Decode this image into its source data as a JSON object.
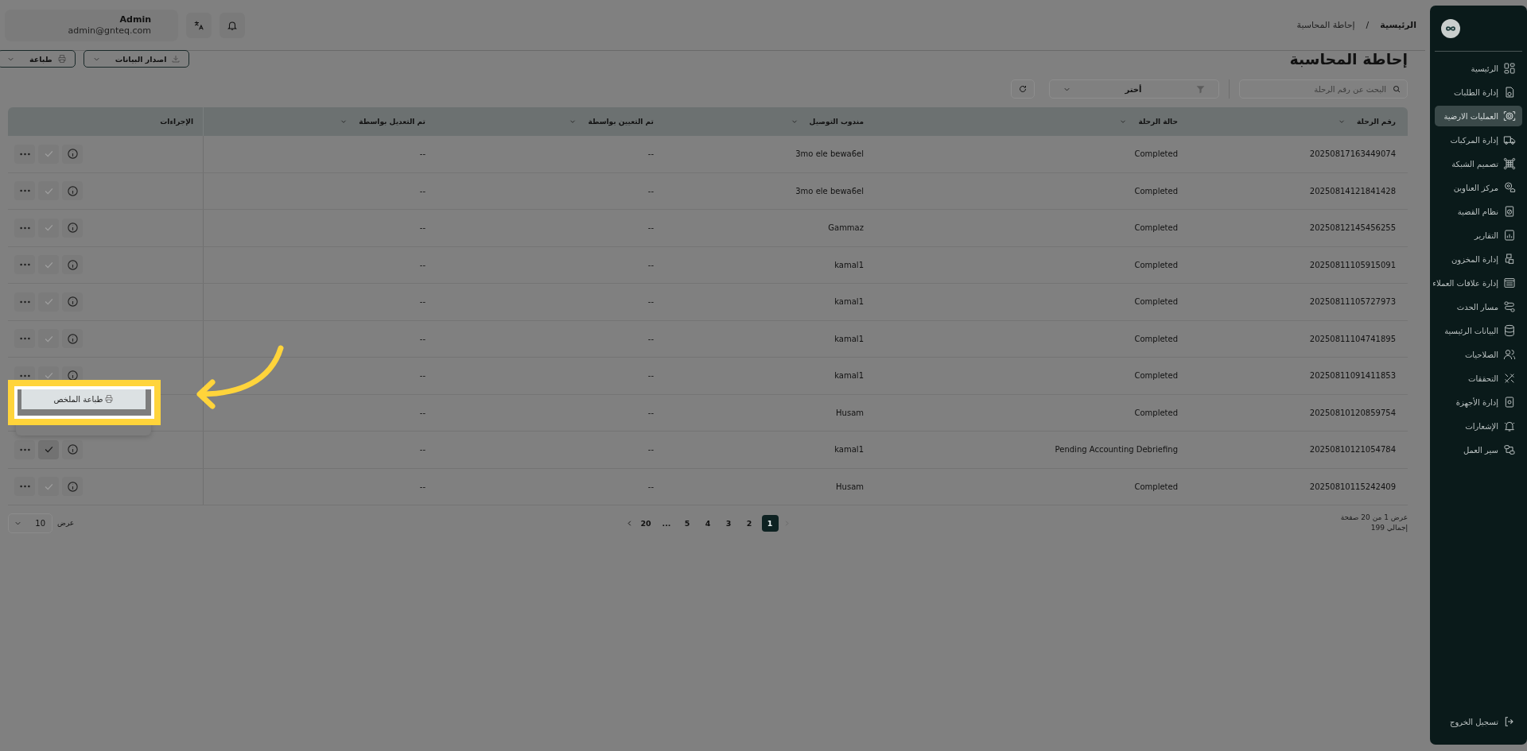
{
  "header": {
    "user": {
      "name": "Admin",
      "email": "admin@gnteq.com"
    },
    "breadcrumb": [
      {
        "label": "الرئيسية",
        "current": false
      },
      {
        "label": "إحاطة المحاسبة",
        "current": true
      }
    ],
    "breadcrumb_separator": "/"
  },
  "page": {
    "title": "إحاطة المحاسبة",
    "actions": [
      {
        "label": "اصدار البيانات",
        "kind": "export"
      },
      {
        "label": "طباعة",
        "kind": "print"
      }
    ]
  },
  "toolbar": {
    "search": {
      "placeholder": "البحث عن رقم الرحلة"
    },
    "filter": {
      "value": "أختر"
    }
  },
  "table": {
    "columns": [
      {
        "label": "رقم الرحلة",
        "sortable": true
      },
      {
        "label": "حالة الرحلة",
        "sortable": true
      },
      {
        "label": "مندوب التوصيل",
        "sortable": true
      },
      {
        "label": "تم التعيين بواسطة",
        "sortable": true
      },
      {
        "label": "تم التعديل بواسطة",
        "sortable": true
      },
      {
        "label": "الإجراءات",
        "sortable": false
      }
    ],
    "rows": [
      {
        "trip": "20250817163449074",
        "state": "Completed",
        "courier": "3mo ele bewa6el",
        "assigned_by": "--",
        "modified_by": "--",
        "approve_enabled": false
      },
      {
        "trip": "20250814121841428",
        "state": "Completed",
        "courier": "3mo ele bewa6el",
        "assigned_by": "--",
        "modified_by": "--",
        "approve_enabled": false
      },
      {
        "trip": "20250812145456255",
        "state": "Completed",
        "courier": "Gammaz",
        "assigned_by": "--",
        "modified_by": "--",
        "approve_enabled": false
      },
      {
        "trip": "20250811105915091",
        "state": "Completed",
        "courier": "kamal1",
        "assigned_by": "--",
        "modified_by": "--",
        "approve_enabled": false
      },
      {
        "trip": "20250811105727973",
        "state": "Completed",
        "courier": "kamal1",
        "assigned_by": "--",
        "modified_by": "--",
        "approve_enabled": false
      },
      {
        "trip": "20250811104741895",
        "state": "Completed",
        "courier": "kamal1",
        "assigned_by": "--",
        "modified_by": "--",
        "approve_enabled": false
      },
      {
        "trip": "20250811091411853",
        "state": "Completed",
        "courier": "kamal1",
        "assigned_by": "--",
        "modified_by": "--",
        "approve_enabled": false
      },
      {
        "trip": "20250810120859754",
        "state": "Completed",
        "courier": "Husam",
        "assigned_by": "--",
        "modified_by": "--"
      },
      {
        "trip": "20250810121054784",
        "state": "Pending Accounting Debriefing",
        "courier": "kamal1",
        "assigned_by": "--",
        "modified_by": "--",
        "approve_enabled": true
      },
      {
        "trip": "20250810115242409",
        "state": "Completed",
        "courier": "Husam",
        "assigned_by": "--",
        "modified_by": "--",
        "approve_enabled": false
      }
    ]
  },
  "row_menu": {
    "items": [
      {
        "label": "طباعة الملخص",
        "highlighted": true
      }
    ]
  },
  "pagination": {
    "summary": "عرض 1 من 20 صفحة",
    "total": "إجمالي 199",
    "page_size_label": "عرض",
    "page_size": "10",
    "pages": [
      {
        "label": "1",
        "selected": true
      },
      {
        "label": "2",
        "selected": false
      },
      {
        "label": "3",
        "selected": false
      },
      {
        "label": "4",
        "selected": false
      },
      {
        "label": "5",
        "selected": false
      },
      {
        "label": "...",
        "selected": false
      },
      {
        "label": "20",
        "selected": false
      }
    ]
  },
  "sidebar": {
    "items": [
      {
        "label": "الرئيسية",
        "selected": false
      },
      {
        "label": "إدارة الطلبات",
        "selected": false
      },
      {
        "label": "العمليات الارضية",
        "selected": true
      },
      {
        "label": "إدارة المركبات",
        "selected": false
      },
      {
        "label": "تصميم الشبكة",
        "selected": false
      },
      {
        "label": "مركز العناوين",
        "selected": false
      },
      {
        "label": "نظام القضية",
        "selected": false
      },
      {
        "label": "التقارير",
        "selected": false
      },
      {
        "label": "إدارة المخزون",
        "selected": false
      },
      {
        "label": "إدارة علاقات العملاء",
        "selected": false
      },
      {
        "label": "مسار الحدث",
        "selected": false
      },
      {
        "label": "البيانات الرئيسية",
        "selected": false
      },
      {
        "label": "الصلاحيات",
        "selected": false
      },
      {
        "label": "التحققات",
        "selected": false
      },
      {
        "label": "إدارة الأجهزة",
        "selected": false
      },
      {
        "label": "الإشعارات",
        "selected": false
      },
      {
        "label": "سير العمل",
        "selected": false
      }
    ],
    "logout": "تسجيل الخروج"
  }
}
